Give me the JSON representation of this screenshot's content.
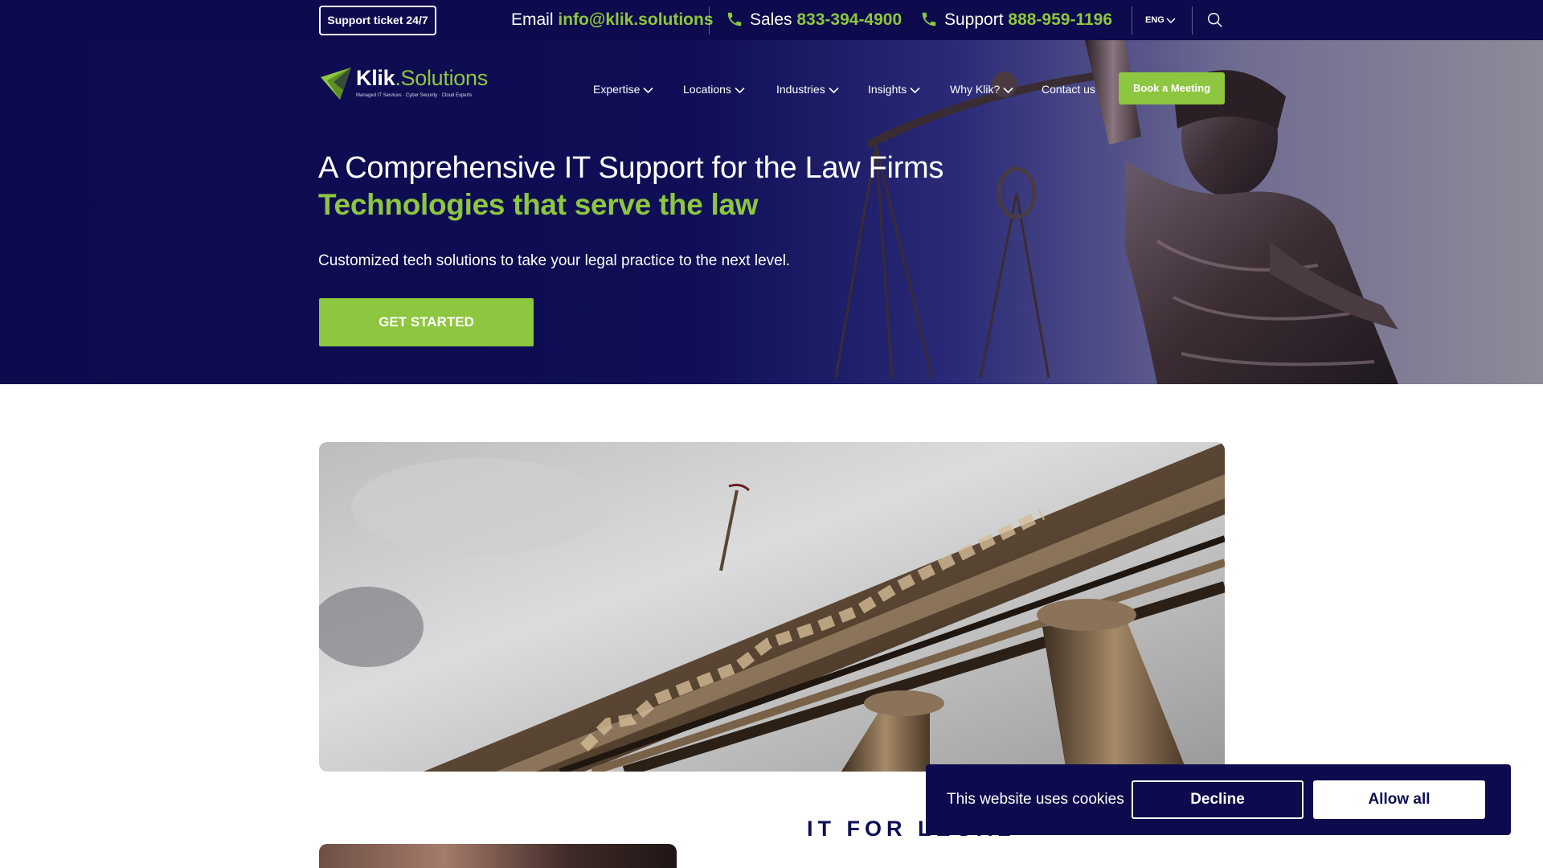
{
  "topbar": {
    "support_ticket_label": "Support ticket 24/7",
    "email_label": "Email",
    "email_value": "info@klik.solutions",
    "sales_label": "Sales",
    "sales_number": "833-394-4900",
    "support_label": "Support",
    "support_number": "888-959-1196",
    "language": "ENG"
  },
  "brand": {
    "name_main": "Klik",
    "name_dot": ".Solutions",
    "tagline": "Managed IT Services · Cyber Security · Cloud Experts"
  },
  "nav": {
    "items": [
      {
        "label": "Expertise"
      },
      {
        "label": "Locations"
      },
      {
        "label": "Industries"
      },
      {
        "label": "Insights"
      },
      {
        "label": "Why Klik?"
      },
      {
        "label": "Contact us"
      }
    ],
    "book_label": "Book a Meeting"
  },
  "hero": {
    "title": "A Comprehensive IT Support for the Law Firms",
    "subtitle": "Technologies that serve the law",
    "description": "Customized tech solutions to take your legal practice to the next level.",
    "cta_label": "GET STARTED"
  },
  "main": {
    "section_label": "IT FOR LEGAL"
  },
  "cookie": {
    "text": "This website uses cookies",
    "decline_label": "Decline",
    "allow_label": "Allow all"
  },
  "colors": {
    "navy": "#0d0b4d",
    "accent_green": "#8dc63f",
    "white": "#ffffff"
  }
}
